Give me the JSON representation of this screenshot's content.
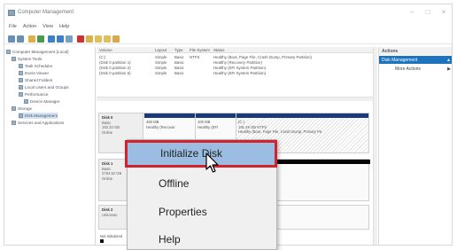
{
  "window": {
    "title": "Computer Management",
    "controls": [
      "–",
      "□",
      "×"
    ]
  },
  "menu": [
    "File",
    "Action",
    "View",
    "Help"
  ],
  "tree": {
    "items": [
      "Computer Management (Local)",
      "System Tools",
      "Task Scheduler",
      "Event Viewer",
      "Shared Folders",
      "Local Users and Groups",
      "Performance",
      "Device Manager",
      "Storage",
      "Disk Management",
      "Services and Applications"
    ]
  },
  "volumes": {
    "headers": [
      "Volume",
      "Layout",
      "Type",
      "File System",
      "Status"
    ],
    "rows": [
      [
        "(C:)",
        "Simple",
        "Basic",
        "NTFS",
        "Healthy (Boot, Page File, Crash Dump, Primary Partition)"
      ],
      [
        "(Disk 0 partition 1)",
        "Simple",
        "Basic",
        "",
        "Healthy (Recovery Partition)"
      ],
      [
        "(Disk 0 partition 2)",
        "Simple",
        "Basic",
        "",
        "Healthy (EFI System Partition)"
      ],
      [
        "(Disk 0 partition 5)",
        "Simple",
        "Basic",
        "",
        "Healthy (EFI System Partition)"
      ]
    ]
  },
  "disks": {
    "disk0": {
      "name": "Disk 0",
      "lines": [
        "Basic",
        "192.32 GB",
        "Online"
      ],
      "partitions": [
        {
          "size": "450 MB",
          "status": "Healthy (Recovar"
        },
        {
          "size": "100 MB",
          "status": "Healthy (EFI"
        },
        {
          "name": "(C:)",
          "size": "191.49 GB NTFS",
          "status": "Healthy (Boot, Page File, Crash Dump, Primary Pa"
        }
      ]
    },
    "disk1": {
      "name": "Disk 1",
      "lines": [
        "Basic",
        "2794.52 GB",
        "Online"
      ]
    },
    "disk2": {
      "name": "Disk 2",
      "lines": [
        "Unknown"
      ]
    },
    "legend": "Not Initialized"
  },
  "actions": {
    "header": "Actions",
    "selected": "Disk Management",
    "more": "More Actions"
  },
  "context_menu": {
    "items": [
      "Initialize Disk",
      "Offline",
      "Properties",
      "Help"
    ],
    "highlighted": "Initialize Disk"
  },
  "colors": {
    "highlight_border": "#d2222d",
    "highlight_fill": "#9bbde2",
    "partition_bar": "#1b3a78",
    "selection_blue": "#1e73be"
  }
}
